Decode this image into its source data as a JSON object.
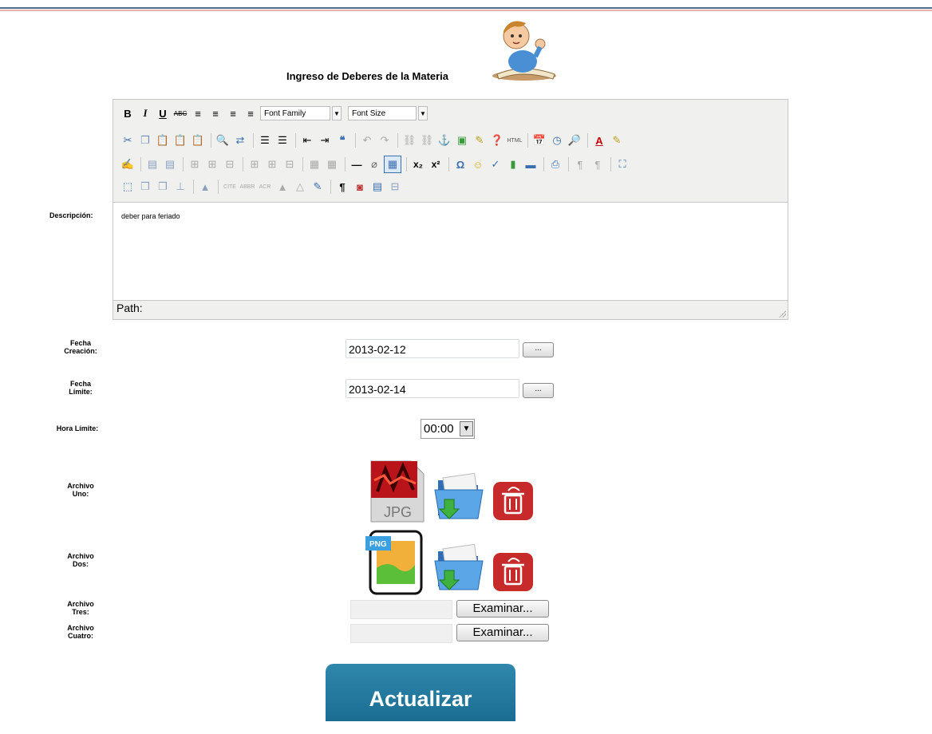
{
  "title": "Ingreso de Deberes de la Materia",
  "labels": {
    "descripcion": "Descripción:",
    "fecha_creacion": [
      "Fecha",
      "Creación:"
    ],
    "fecha_limite": [
      "Fecha",
      "Límite:"
    ],
    "hora_limite": "Hora Límite:",
    "archivo_uno": [
      "Archivo",
      "Uno:"
    ],
    "archivo_dos": [
      "Archivo",
      "Dos:"
    ],
    "archivo_tres": [
      "Archivo",
      "Tres:"
    ],
    "archivo_cuatro": [
      "Archivo",
      "Cuatro:"
    ]
  },
  "editor": {
    "font_family": "Font Family",
    "font_size": "Font Size",
    "content": "deber para feriado",
    "path_label": "Path:"
  },
  "fields": {
    "fecha_creacion": "2013-02-12",
    "fecha_limite": "2013-02-14",
    "hora_limite": "00:00",
    "picker_label": "..."
  },
  "files": {
    "uno_type": "JPG",
    "dos_type": "PNG",
    "examinar": "Examinar..."
  },
  "submit": "Actualizar",
  "colors": {
    "accent": "#2480a6",
    "delete_red": "#c62a2a",
    "folder_blue": "#3c8ed6"
  }
}
